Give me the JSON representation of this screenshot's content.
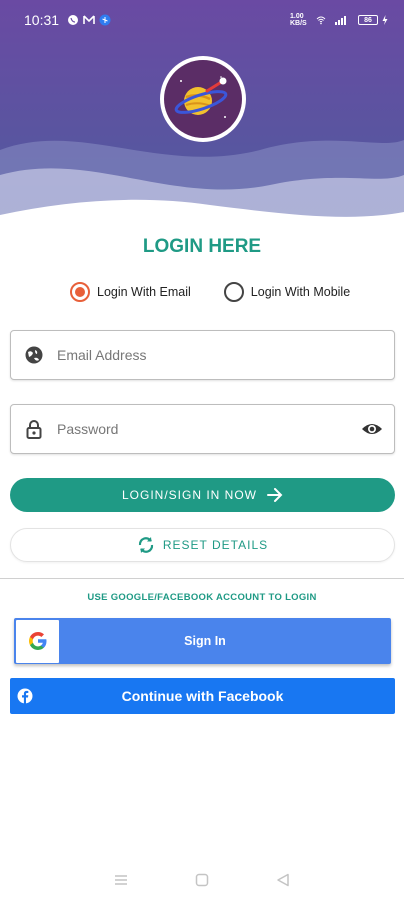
{
  "status_bar": {
    "time": "10:31",
    "network_speed": "1.00 KB/S",
    "battery": "86"
  },
  "logo": {
    "icon": "planet-rocket-logo-icon"
  },
  "login_title": "LOGIN HERE",
  "login_mode": {
    "options": [
      {
        "label": "Login With Email",
        "selected": true
      },
      {
        "label": "Login With Mobile",
        "selected": false
      }
    ]
  },
  "email_field": {
    "placeholder": "Email Address",
    "value": "",
    "icon": "globe-icon"
  },
  "password_field": {
    "placeholder": "Password",
    "value": "",
    "icon": "lock-icon",
    "toggle_icon": "eye-icon"
  },
  "primary_button": {
    "label": "LOGIN/SIGN IN NOW",
    "icon": "arrow-right-icon"
  },
  "reset_button": {
    "label": "RESET DETAILS",
    "icon": "refresh-icon"
  },
  "social": {
    "hint": "USE GOOGLE/FACEBOOK ACCOUNT TO LOGIN",
    "google_label": "Sign In",
    "facebook_label": "Continue with Facebook"
  },
  "colors": {
    "accent": "#1f9a85",
    "radio_selected": "#e8603a",
    "header_purple": "#5e4aa0",
    "google_blue": "#4a84ec",
    "facebook_blue": "#1877f2"
  }
}
